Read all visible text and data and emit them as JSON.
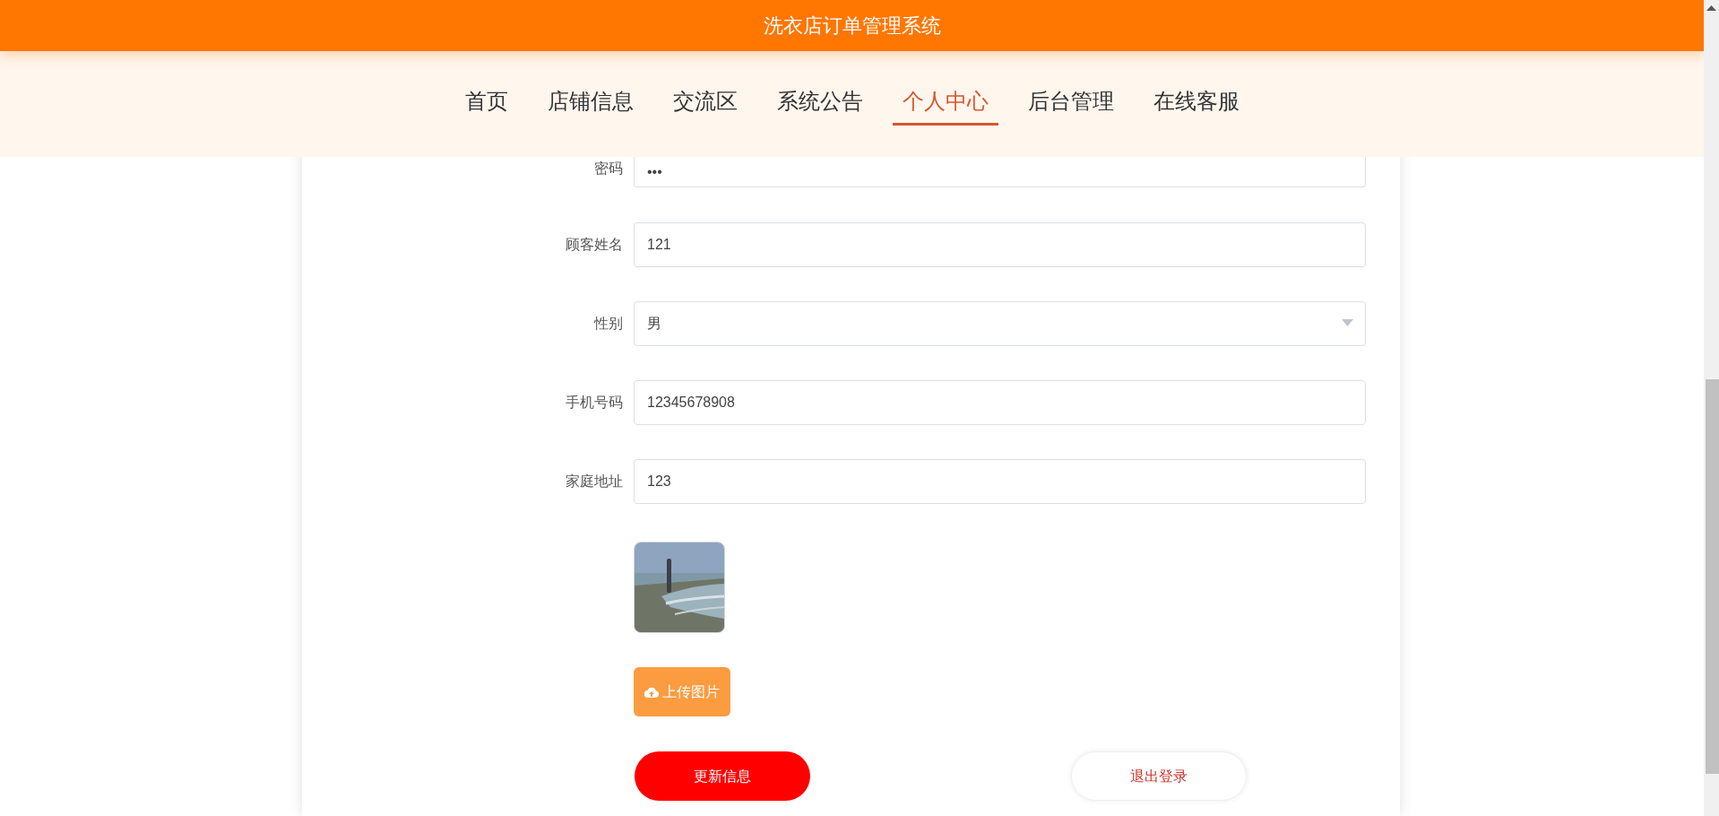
{
  "header": {
    "title": "洗衣店订单管理系统"
  },
  "nav": [
    {
      "label": "首页",
      "selected": false
    },
    {
      "label": "店铺信息",
      "selected": false
    },
    {
      "label": "交流区",
      "selected": false
    },
    {
      "label": "系统公告",
      "selected": false
    },
    {
      "label": "个人中心",
      "selected": true
    },
    {
      "label": "后台管理",
      "selected": false
    },
    {
      "label": "在线客服",
      "selected": false
    }
  ],
  "form": {
    "fields": [
      {
        "label": "密码",
        "kind": "text",
        "value": "•••"
      },
      {
        "label": "顾客姓名",
        "kind": "text",
        "value": "121"
      },
      {
        "label": "性别",
        "kind": "select",
        "value": "男"
      },
      {
        "label": "手机号码",
        "kind": "text",
        "value": "12345678908"
      },
      {
        "label": "家庭地址",
        "kind": "text",
        "value": "123"
      }
    ],
    "upload_button": "上传图片",
    "update_button": "更新信息",
    "logout_button": "退出登录"
  }
}
